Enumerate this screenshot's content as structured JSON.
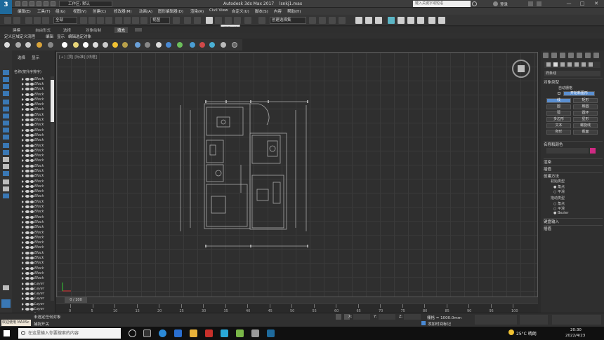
{
  "app": {
    "logo": "3",
    "window_title": "Autodesk 3ds Max 2017",
    "file_name": "lsnkj1.max",
    "workspace": "工作区: 默认",
    "search_placeholder": "键入关键字或短语",
    "login": "登录",
    "window_controls": [
      "—",
      "□",
      "✕"
    ]
  },
  "menu": [
    "编辑(E)",
    "工具(T)",
    "组(G)",
    "视图(V)",
    "创建(C)",
    "修改器(M)",
    "动画(A)",
    "图形编辑器(D)",
    "渲染(R)",
    "Civil View",
    "自定义(U)",
    "脚本(S)",
    "内容",
    "帮助(H)"
  ],
  "toolbar": {
    "filter_dropdown": "全部",
    "view_dropdown": "视图",
    "selection_set_dropdown": "创建选择集",
    "tooltip": "捕捉开关"
  },
  "ribbon": {
    "tabs": [
      "建模",
      "自由形式",
      "选择",
      "对象绘制",
      "填充"
    ],
    "selected": "填充"
  },
  "subbar": [
    "定义区域",
    "定义流程",
    "编辑",
    "显示",
    "编辑选定对象"
  ],
  "scene_panel": {
    "tabs": [
      "选择",
      "显示"
    ],
    "header": "名称(按升序排序)",
    "rows": [
      "Block",
      "Block",
      "Block",
      "Block",
      "Block",
      "Block",
      "Block",
      "Block",
      "Block",
      "Block",
      "Block",
      "Block",
      "Block",
      "Block",
      "Block",
      "Block",
      "Block",
      "Block",
      "Block",
      "Block",
      "Block",
      "Block",
      "Block",
      "Block",
      "Block",
      "Block",
      "Block",
      "Block",
      "Block",
      "Block",
      "Block",
      "Block",
      "Block",
      "Block",
      "Block",
      "Block",
      "Block",
      "Block",
      "Block",
      "Block",
      "Layer",
      "Layer",
      "Layer",
      "Layer",
      "Layer",
      "Layer",
      "Layer",
      "Layer",
      "Layer",
      "Layer"
    ]
  },
  "viewport": {
    "label": "[+] [顶] [标准] [线框]"
  },
  "command_panel": {
    "dropdown": "样条线",
    "sections": {
      "object_type": "对象类型",
      "auto_grid": "自动栅格",
      "start_new_shape": "开始新图形",
      "name_color": "名称和颜色",
      "render": "渲染",
      "interpolation": "插值",
      "creation_method": "创建方法",
      "initial_type": "初始类型",
      "drag_type": "拖动类型",
      "keyboard_input": "键盘输入"
    },
    "object_buttons": [
      "线",
      "矩形",
      "圆",
      "椭圆",
      "弧",
      "圆环",
      "多边形",
      "星形",
      "文本",
      "螺旋线",
      "卵形",
      "截面"
    ],
    "initial_types": [
      "角点",
      "平滑"
    ],
    "drag_types": [
      "角点",
      "平滑",
      "Bezier"
    ],
    "accent_color": "#cf2a83"
  },
  "timeline": {
    "slider": "0 / 100",
    "ticks": [
      "0",
      "5",
      "10",
      "15",
      "20",
      "25",
      "30",
      "35",
      "40",
      "45",
      "50",
      "55",
      "60",
      "65",
      "70",
      "75",
      "80",
      "85",
      "90",
      "95",
      "100"
    ]
  },
  "status": {
    "welcome": "欢迎使用 MAXSc",
    "selection": "未选定任何对象",
    "prompt": "捕捉开关",
    "x_label": "X:",
    "y_label": "Y:",
    "z_label": "Z:",
    "grid": "栅格 = 1000.0mm",
    "add_time_tag": "添加时间标记"
  },
  "taskbar": {
    "search": "在这里输入你要搜索的内容",
    "weather": "25°C  晴朗",
    "time": "20:30",
    "date": "2022/4/23"
  }
}
